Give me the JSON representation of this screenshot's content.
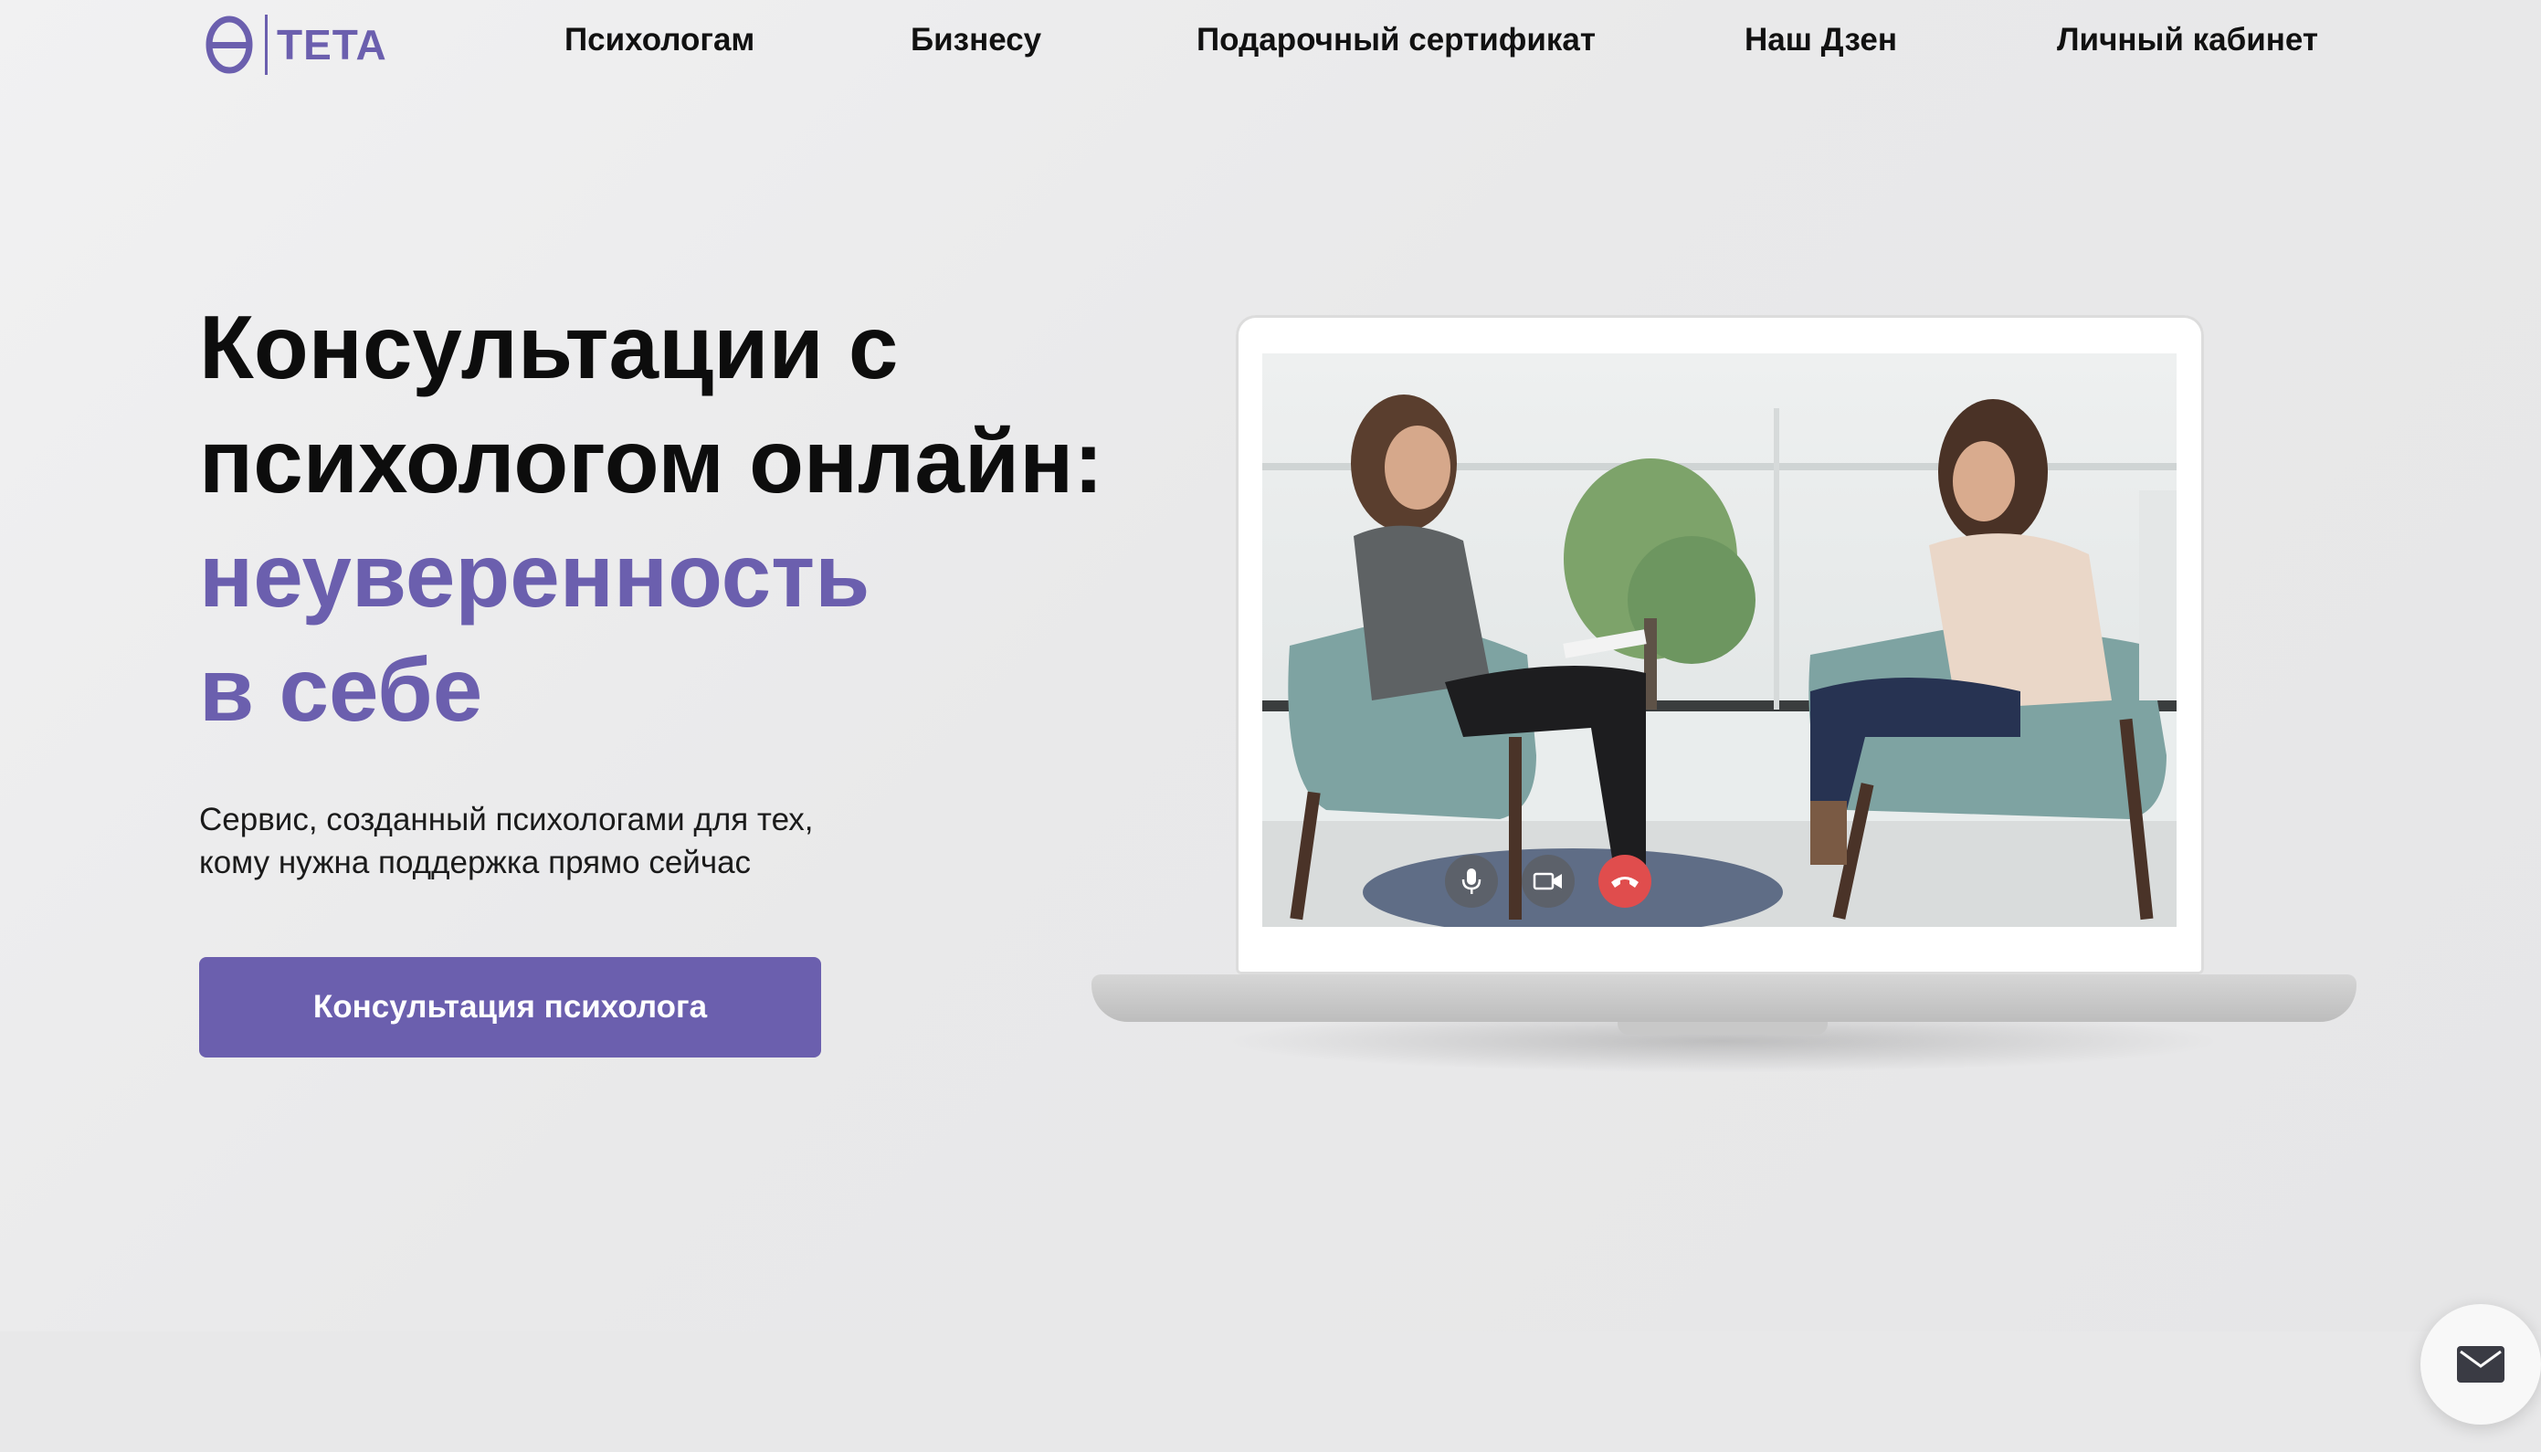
{
  "header": {
    "logo_text": "TETA",
    "logo_icon": "theta-icon",
    "nav": [
      {
        "label": "Психологам"
      },
      {
        "label": "Бизнесу"
      },
      {
        "label": "Подарочный сертификат"
      },
      {
        "label": "Наш Дзен"
      },
      {
        "label": "Личный кабинет"
      }
    ]
  },
  "hero": {
    "title_line1": "Консультации с",
    "title_line2": "психологом онлайн:",
    "accent_line1": "неуверенность",
    "accent_line2": "в себе",
    "subtitle_line1": "Сервис, созданный психологами для тех,",
    "subtitle_line2": "кому нужна поддержка прямо сейчас",
    "cta_label": "Консультация психолога"
  },
  "video_call": {
    "controls": [
      "mic-icon",
      "camera-icon",
      "end-call-icon"
    ]
  },
  "floating": {
    "icon": "mail-icon"
  },
  "colors": {
    "accent": "#6b5fae",
    "background": "#ebebec",
    "end_call": "#e04d4d"
  }
}
